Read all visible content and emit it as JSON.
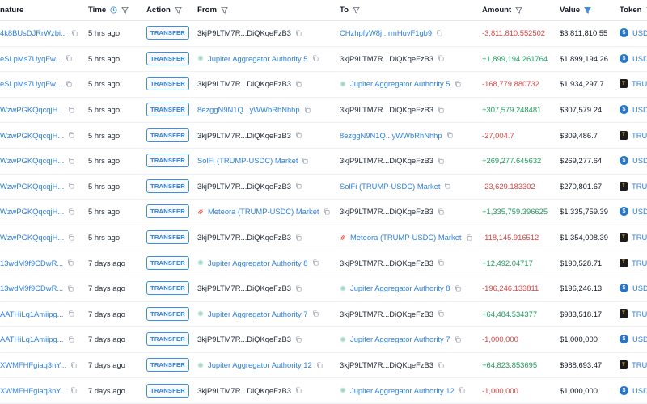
{
  "headers": {
    "signature": "nature",
    "time": "Time",
    "action": "Action",
    "from": "From",
    "to": "To",
    "amount": "Amount",
    "value": "Value",
    "token": "Token"
  },
  "colors": {
    "link": "#2f80d8",
    "positive": "#1e9b5c",
    "negative": "#d64545",
    "badge": "#3b8ee5"
  },
  "rows": [
    {
      "sig": "4k8BUsDJRrWzbi...",
      "time": "5 hrs ago",
      "action": "TRANSFER",
      "from": "3kjP9LTM7R...DiQKqeFzB3",
      "from_type": "dark",
      "from_icon": "",
      "to": "CHzhpfyW8j...rmHuvF1gb9",
      "to_type": "link",
      "to_icon": "",
      "amount": "-3,811,810.552502",
      "amount_sign": "neg",
      "value": "$3,811,810.55",
      "token": "USDC",
      "token_kind": "usdc"
    },
    {
      "sig": "eSLpMs7UyqFw...",
      "time": "5 hrs ago",
      "action": "TRANSFER",
      "from": "Jupiter Aggregator Authority 5",
      "from_type": "link",
      "from_icon": "jup",
      "to": "3kjP9LTM7R...DiQKqeFzB3",
      "to_type": "dark",
      "to_icon": "",
      "amount": "+1,899,194.261764",
      "amount_sign": "pos",
      "value": "$1,899,194.26",
      "token": "USDC",
      "token_kind": "usdc"
    },
    {
      "sig": "eSLpMs7UyqFw...",
      "time": "5 hrs ago",
      "action": "TRANSFER",
      "from": "3kjP9LTM7R...DiQKqeFzB3",
      "from_type": "dark",
      "from_icon": "",
      "to": "Jupiter Aggregator Authority 5",
      "to_type": "link",
      "to_icon": "jup",
      "amount": "-168,779.880732",
      "amount_sign": "neg",
      "value": "$1,934,297.7",
      "token": "TRUMP",
      "token_kind": "trump"
    },
    {
      "sig": "WzwPGKQqcqjH...",
      "time": "5 hrs ago",
      "action": "TRANSFER",
      "from": "8ezggN9N1Q...yWWbRhNhhp",
      "from_type": "link",
      "from_icon": "",
      "to": "3kjP9LTM7R...DiQKqeFzB3",
      "to_type": "dark",
      "to_icon": "",
      "amount": "+307,579.248481",
      "amount_sign": "pos",
      "value": "$307,579.24",
      "token": "USDC",
      "token_kind": "usdc"
    },
    {
      "sig": "WzwPGKQqcqjH...",
      "time": "5 hrs ago",
      "action": "TRANSFER",
      "from": "3kjP9LTM7R...DiQKqeFzB3",
      "from_type": "dark",
      "from_icon": "",
      "to": "8ezggN9N1Q...yWWbRhNhhp",
      "to_type": "link",
      "to_icon": "",
      "amount": "-27,004.7",
      "amount_sign": "neg",
      "value": "$309,486.7",
      "token": "TRUMP",
      "token_kind": "trump"
    },
    {
      "sig": "WzwPGKQqcqjH...",
      "time": "5 hrs ago",
      "action": "TRANSFER",
      "from": "SolFi (TRUMP-USDC) Market",
      "from_type": "link",
      "from_icon": "",
      "to": "3kjP9LTM7R...DiQKqeFzB3",
      "to_type": "dark",
      "to_icon": "",
      "amount": "+269,277.645632",
      "amount_sign": "pos",
      "value": "$269,277.64",
      "token": "USDC",
      "token_kind": "usdc"
    },
    {
      "sig": "WzwPGKQqcqjH...",
      "time": "5 hrs ago",
      "action": "TRANSFER",
      "from": "3kjP9LTM7R...DiQKqeFzB3",
      "from_type": "dark",
      "from_icon": "",
      "to": "SolFi (TRUMP-USDC) Market",
      "to_type": "link",
      "to_icon": "",
      "amount": "-23,629.183302",
      "amount_sign": "neg",
      "value": "$270,801.67",
      "token": "TRUMP",
      "token_kind": "trump"
    },
    {
      "sig": "WzwPGKQqcqjH...",
      "time": "5 hrs ago",
      "action": "TRANSFER",
      "from": "Meteora (TRUMP-USDC) Market",
      "from_type": "link",
      "from_icon": "met",
      "to": "3kjP9LTM7R...DiQKqeFzB3",
      "to_type": "dark",
      "to_icon": "",
      "amount": "+1,335,759.396625",
      "amount_sign": "pos",
      "value": "$1,335,759.39",
      "token": "USDC",
      "token_kind": "usdc"
    },
    {
      "sig": "WzwPGKQqcqjH...",
      "time": "5 hrs ago",
      "action": "TRANSFER",
      "from": "3kjP9LTM7R...DiQKqeFzB3",
      "from_type": "dark",
      "from_icon": "",
      "to": "Meteora (TRUMP-USDC) Market",
      "to_type": "link",
      "to_icon": "met",
      "amount": "-118,145.916512",
      "amount_sign": "neg",
      "value": "$1,354,008.39",
      "token": "TRUMP",
      "token_kind": "trump"
    },
    {
      "sig": "13wdM9f9CDwR...",
      "time": "7 days ago",
      "action": "TRANSFER",
      "from": "Jupiter Aggregator Authority 8",
      "from_type": "link",
      "from_icon": "jup",
      "to": "3kjP9LTM7R...DiQKqeFzB3",
      "to_type": "dark",
      "to_icon": "",
      "amount": "+12,492.04717",
      "amount_sign": "pos",
      "value": "$190,528.71",
      "token": "TRUMP",
      "token_kind": "trump"
    },
    {
      "sig": "13wdM9f9CDwR...",
      "time": "7 days ago",
      "action": "TRANSFER",
      "from": "3kjP9LTM7R...DiQKqeFzB3",
      "from_type": "dark",
      "from_icon": "",
      "to": "Jupiter Aggregator Authority 8",
      "to_type": "link",
      "to_icon": "jup",
      "amount": "-196,246.133811",
      "amount_sign": "neg",
      "value": "$196,246.13",
      "token": "USDC",
      "token_kind": "usdc"
    },
    {
      "sig": "AATHiLq1Amiipg...",
      "time": "7 days ago",
      "action": "TRANSFER",
      "from": "Jupiter Aggregator Authority 7",
      "from_type": "link",
      "from_icon": "jup",
      "to": "3kjP9LTM7R...DiQKqeFzB3",
      "to_type": "dark",
      "to_icon": "",
      "amount": "+64,484.534377",
      "amount_sign": "pos",
      "value": "$983,518.17",
      "token": "TRUMP",
      "token_kind": "trump"
    },
    {
      "sig": "AATHiLq1Amiipg...",
      "time": "7 days ago",
      "action": "TRANSFER",
      "from": "3kjP9LTM7R...DiQKqeFzB3",
      "from_type": "dark",
      "from_icon": "",
      "to": "Jupiter Aggregator Authority 7",
      "to_type": "link",
      "to_icon": "jup",
      "amount": "-1,000,000",
      "amount_sign": "neg",
      "value": "$1,000,000",
      "token": "USDC",
      "token_kind": "usdc"
    },
    {
      "sig": "XWMFHFgiaq3nY...",
      "time": "7 days ago",
      "action": "TRANSFER",
      "from": "Jupiter Aggregator Authority 12",
      "from_type": "link",
      "from_icon": "jup",
      "to": "3kjP9LTM7R...DiQKqeFzB3",
      "to_type": "dark",
      "to_icon": "",
      "amount": "+64,823.853695",
      "amount_sign": "pos",
      "value": "$988,693.47",
      "token": "TRUMP",
      "token_kind": "trump"
    },
    {
      "sig": "XWMFHFgiaq3nY...",
      "time": "7 days ago",
      "action": "TRANSFER",
      "from": "3kjP9LTM7R...DiQKqeFzB3",
      "from_type": "dark",
      "from_icon": "",
      "to": "Jupiter Aggregator Authority 12",
      "to_type": "link",
      "to_icon": "jup",
      "amount": "-1,000,000",
      "amount_sign": "neg",
      "value": "$1,000,000",
      "token": "USDC",
      "token_kind": "usdc"
    }
  ]
}
